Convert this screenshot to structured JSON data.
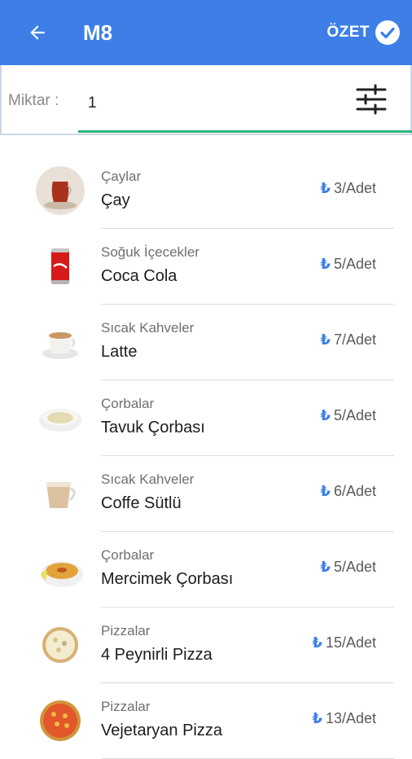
{
  "appbar": {
    "title": "M8",
    "summary_label": "ÖZET",
    "back_icon": "arrow-left-icon",
    "summary_icon": "check-circle-icon"
  },
  "quantity": {
    "label": "Miktar :",
    "value": "1",
    "filter_icon": "sliders-icon"
  },
  "currency_symbol": "₺",
  "colors": {
    "primary": "#3d7fe6",
    "accent": "#2bb37a"
  },
  "items": [
    {
      "category": "Çaylar",
      "name": "Çay",
      "price": "3/Adet",
      "icon": "tea-glass-icon"
    },
    {
      "category": "Soğuk İçecekler",
      "name": "Coca Cola",
      "price": "5/Adet",
      "icon": "cola-can-icon"
    },
    {
      "category": "Sıcak Kahveler",
      "name": "Latte",
      "price": "7/Adet",
      "icon": "latte-cup-icon"
    },
    {
      "category": "Çorbalar",
      "name": "Tavuk Çorbası",
      "price": "5/Adet",
      "icon": "soup-bowl-icon"
    },
    {
      "category": "Sıcak Kahveler",
      "name": "Coffe Sütlü",
      "price": "6/Adet",
      "icon": "milk-coffee-cup-icon"
    },
    {
      "category": "Çorbalar",
      "name": "Mercimek Çorbası",
      "price": "5/Adet",
      "icon": "lentil-soup-icon"
    },
    {
      "category": "Pizzalar",
      "name": "4 Peynirli Pizza",
      "price": "15/Adet",
      "icon": "cheese-pizza-icon"
    },
    {
      "category": "Pizzalar",
      "name": "Vejetaryan Pizza",
      "price": "13/Adet",
      "icon": "vegetarian-pizza-icon"
    }
  ]
}
